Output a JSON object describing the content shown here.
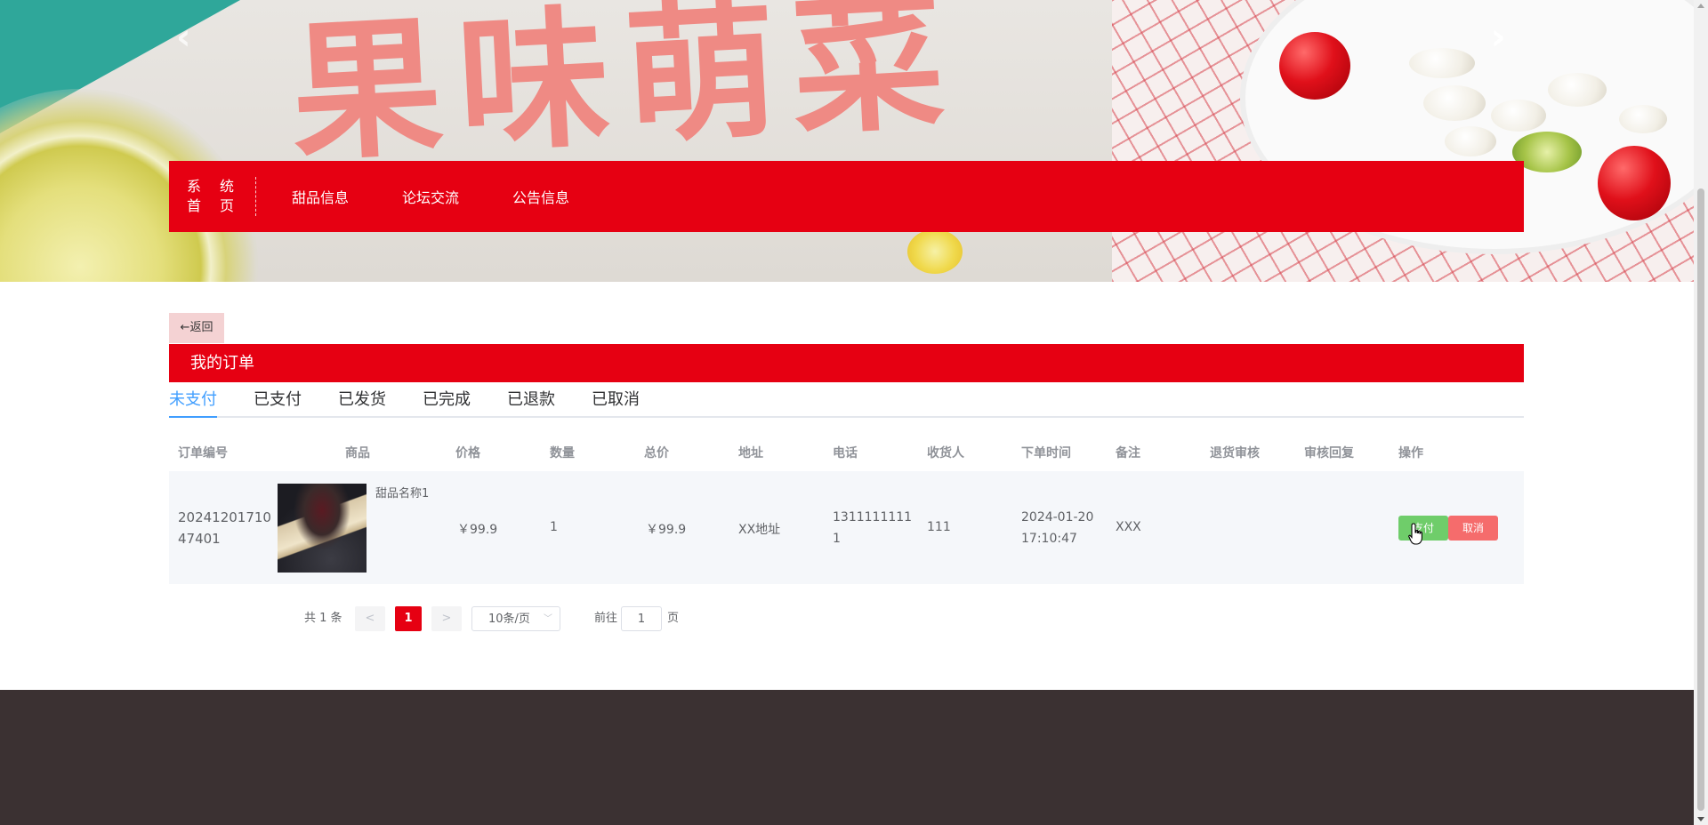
{
  "banner": {
    "title": "果味萌菜",
    "prev_icon": "chevron-left-icon",
    "next_icon": "chevron-right-icon"
  },
  "nav": {
    "home_line1": "系 统",
    "home_line2": "首 页",
    "items": [
      "甜品信息",
      "论坛交流",
      "公告信息"
    ]
  },
  "back_label": "←返回",
  "section_title": "我的订单",
  "tabs": [
    "未支付",
    "已支付",
    "已发货",
    "已完成",
    "已退款",
    "已取消"
  ],
  "active_tab": "未支付",
  "table": {
    "headers": [
      "订单编号",
      "商品",
      "价格",
      "数量",
      "总价",
      "地址",
      "电话",
      "收货人",
      "下单时间",
      "备注",
      "退货审核",
      "审核回复",
      "操作"
    ],
    "rows": [
      {
        "order_no_line1": "20241201710",
        "order_no_line2": "47401",
        "goods_name": "甜品名称1",
        "price": "￥99.9",
        "quantity": "1",
        "total": "￥99.9",
        "address": "XX地址",
        "phone_line1": "1311111111",
        "phone_line2": "1",
        "receiver": "111",
        "order_time_line1": "2024-01-20",
        "order_time_line2": "17:10:47",
        "remark": "XXX",
        "return_review": "",
        "review_reply": "",
        "pay_label": "支付",
        "cancel_label": "取消"
      }
    ]
  },
  "pagination": {
    "total": "共 1 条",
    "prev": "<",
    "current": "1",
    "next": ">",
    "page_size": "10条/页",
    "goto": "前往",
    "goto_value": "1",
    "unit": "页"
  },
  "colors": {
    "brand_red": "#e60012",
    "tab_active": "#409eff",
    "pay_green": "#6fcd6a",
    "cancel_red": "#f56c6c",
    "footer": "#3b3132"
  }
}
